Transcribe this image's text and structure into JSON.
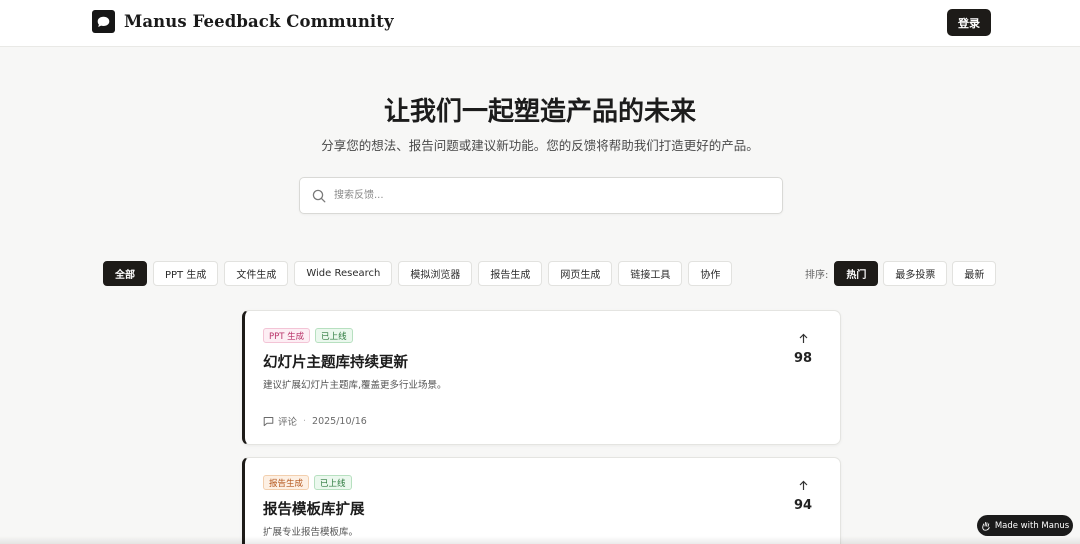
{
  "header": {
    "brand": "Manus Feedback Community",
    "login_label": "登录"
  },
  "hero": {
    "title": "让我们一起塑造产品的未来",
    "subtitle": "分享您的想法、报告问题或建议新功能。您的反馈将帮助我们打造更好的产品。"
  },
  "search": {
    "placeholder": "搜索反馈..."
  },
  "filters": {
    "categories": [
      "全部",
      "PPT 生成",
      "文件生成",
      "Wide Research",
      "模拟浏览器",
      "报告生成",
      "网页生成",
      "链接工具",
      "协作"
    ],
    "active": "全部"
  },
  "sort": {
    "label": "排序:",
    "options": [
      "热门",
      "最多投票",
      "最新"
    ],
    "active": "热门"
  },
  "posts": [
    {
      "category": "PPT 生成",
      "status": "已上线",
      "title": "幻灯片主题库持续更新",
      "description": "建议扩展幻灯片主题库,覆盖更多行业场景。",
      "comment_label": "评论",
      "date": "2025/10/16",
      "votes": "98"
    },
    {
      "category": "报告生成",
      "status": "已上线",
      "title": "报告模板库扩展",
      "description": "扩展专业报告模板库。",
      "votes": "94"
    }
  ],
  "badge": {
    "label": "Made with Manus"
  },
  "colors": {
    "accent": "#1d1b18",
    "background": "#f7f7f6",
    "tag_pink": "#b83268",
    "tag_orange": "#b4561b",
    "tag_green": "#2c7a3e"
  }
}
